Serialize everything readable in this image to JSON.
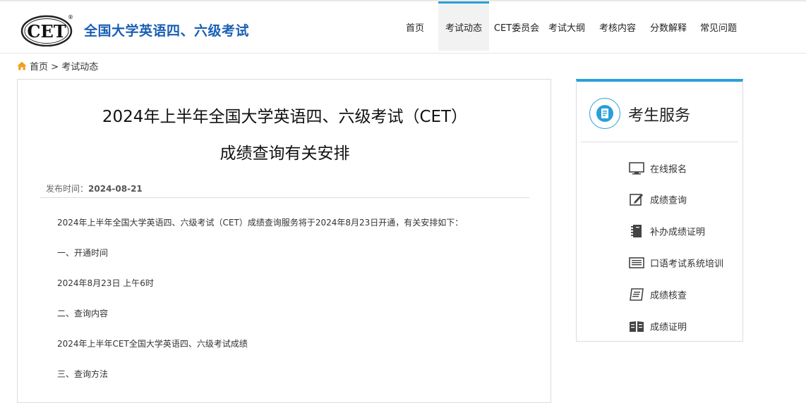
{
  "site": {
    "logo_text": "CET",
    "logo_mark": "®",
    "title": "全国大学英语四、六级考试"
  },
  "nav": {
    "items": [
      {
        "label": "首页",
        "active": false
      },
      {
        "label": "考试动态",
        "active": true
      },
      {
        "label": "CET委员会",
        "active": false
      },
      {
        "label": "考试大纲",
        "active": false
      },
      {
        "label": "考核内容",
        "active": false
      },
      {
        "label": "分数解释",
        "active": false
      },
      {
        "label": "常见问题",
        "active": false
      }
    ]
  },
  "breadcrumb": {
    "home": "首页",
    "separator": ">",
    "current": "考试动态"
  },
  "article": {
    "title_line1": "2024年上半年全国大学英语四、六级考试（CET）",
    "title_line2": "成绩查询有关安排",
    "date_label": "发布时间：",
    "date_value": "2024-08-21",
    "paragraphs": [
      "2024年上半年全国大学英语四、六级考试（CET）成绩查询服务将于2024年8月23日开通，有关安排如下：",
      "一、开通时间",
      "2024年8月23日 上午6时",
      "二、查询内容",
      "2024年上半年CET全国大学英语四、六级考试成绩",
      "三、查询方法"
    ]
  },
  "sidebar": {
    "title": "考生服务",
    "items": [
      {
        "label": "在线报名",
        "icon": "monitor-icon"
      },
      {
        "label": "成绩查询",
        "icon": "edit-icon"
      },
      {
        "label": "补办成绩证明",
        "icon": "notebook-icon"
      },
      {
        "label": "口语考试系统培训",
        "icon": "keyboard-icon"
      },
      {
        "label": "成绩核查",
        "icon": "review-icon"
      },
      {
        "label": "成绩证明",
        "icon": "book-icon"
      }
    ]
  },
  "colors": {
    "accent": "#2aa0d8",
    "title_blue": "#1a5fb4",
    "home_icon": "#f0a020"
  }
}
